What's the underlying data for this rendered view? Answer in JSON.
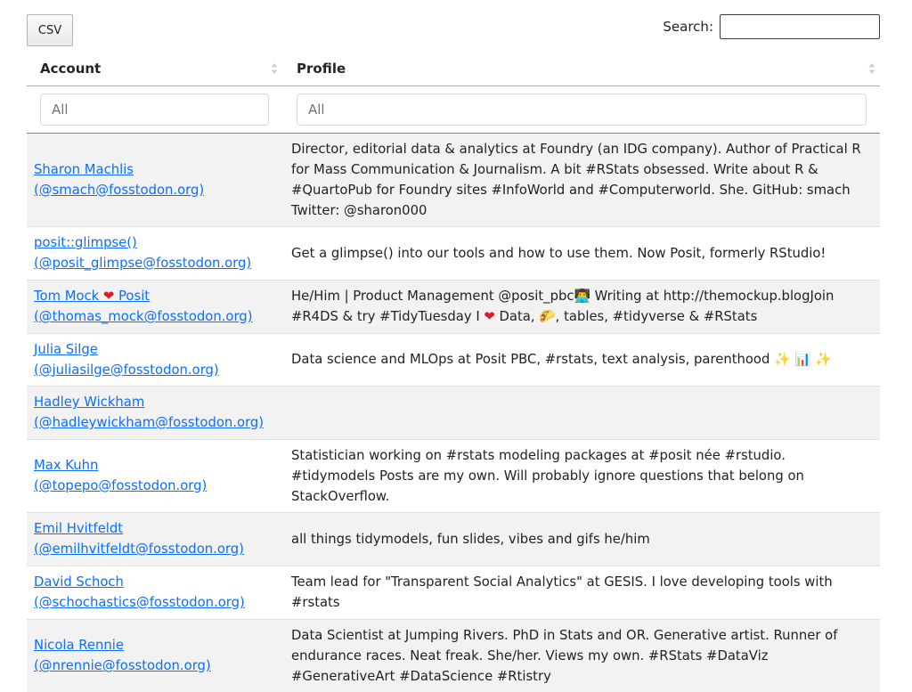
{
  "toolbar": {
    "csv_label": "CSV"
  },
  "search": {
    "label": "Search:",
    "value": ""
  },
  "columns": [
    {
      "label": "Account"
    },
    {
      "label": "Profile"
    }
  ],
  "filters": {
    "account_placeholder": "All",
    "profile_placeholder": "All"
  },
  "rows": [
    {
      "account_lines": [
        "Sharon Machlis",
        "(@smach@fosstodon.org)"
      ],
      "profile": "Director, editorial data & analytics at Foundry (an IDG company). Author of Practical R for Mass Communication & Journalism. A bit #RStats obsessed. Write about R & #QuartoPub for Foundry sites #InfoWorld and #Computerworld. She. GitHub: smach Twitter: @sharon000"
    },
    {
      "account_lines": [
        "posit::glimpse()",
        "(@posit_glimpse@fosstodon.org)"
      ],
      "profile": "Get a glimpse() into our tools and how to use them. Now Posit, formerly RStudio!"
    },
    {
      "account_lines": [
        "Tom Mock ❤ Posit",
        "(@thomas_mock@fosstodon.org)"
      ],
      "profile": "He/Him | Product Management @posit_pbc👨‍💻 Writing at http://themockup.blogJoin #R4DS & try #TidyTuesday I ❤ Data, 🌮, tables, #tidyverse & #RStats"
    },
    {
      "account_lines": [
        "Julia Silge (@juliasilge@fosstodon.org)"
      ],
      "profile": "Data science and MLOps at Posit PBC, #rstats, text analysis, parenthood ✨ 📊 ✨"
    },
    {
      "account_lines": [
        "Hadley Wickham",
        "(@hadleywickham@fosstodon.org)"
      ],
      "profile": ""
    },
    {
      "account_lines": [
        "Max Kuhn (@topepo@fosstodon.org)"
      ],
      "profile": "Statistician working on #rstats modeling packages at #posit née #rstudio. #tidymodels Posts are my own. Will probably ignore questions that belong on StackOverflow."
    },
    {
      "account_lines": [
        "Emil Hvitfeldt",
        "(@emilhvitfeldt@fosstodon.org)"
      ],
      "profile": "all things tidymodels, fun slides, vibes and gifs he/him"
    },
    {
      "account_lines": [
        "David Schoch",
        "(@schochastics@fosstodon.org)"
      ],
      "profile": "Team lead for \"Transparent Social Analytics\" at GESIS. I love developing tools with #rstats"
    },
    {
      "account_lines": [
        "Nicola Rennie",
        "(@nrennie@fosstodon.org)"
      ],
      "profile": "Data Scientist at Jumping Rivers. PhD in Stats and OR. Generative artist. Runner of endurance races. Neat freak. She/her. Views my own. #RStats #DataViz #GenerativeArt #DataScience #Rtistry"
    }
  ],
  "colors": {
    "link": "#0d6efd",
    "stripe": "#f2f2f2",
    "heart": "#d81e2c"
  }
}
